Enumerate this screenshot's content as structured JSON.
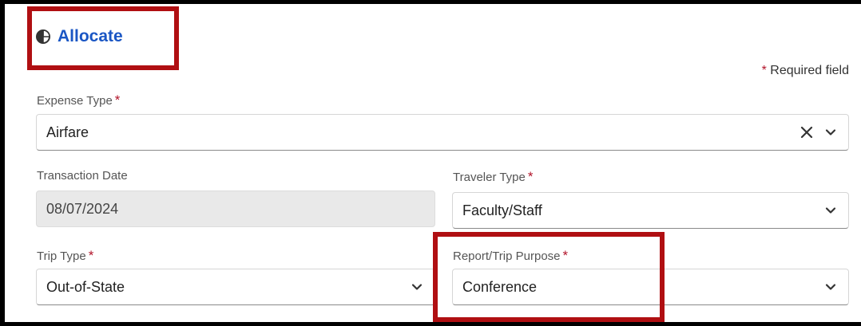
{
  "header": {
    "allocate_label": "Allocate",
    "allocate_icon": "pie-chart-icon",
    "required_note": "Required field",
    "required_marker": "*"
  },
  "fields": {
    "expense_type": {
      "label": "Expense Type",
      "value": "Airfare",
      "icons": [
        "clear-icon",
        "chevron-down-icon"
      ]
    },
    "transaction_date": {
      "label": "Transaction Date",
      "value": "08/07/2024"
    },
    "traveler_type": {
      "label": "Traveler Type",
      "value": "Faculty/Staff",
      "icons": [
        "chevron-down-icon"
      ]
    },
    "trip_type": {
      "label": "Trip Type",
      "value": "Out-of-State",
      "icons": [
        "chevron-down-icon"
      ]
    },
    "report_trip_purpose": {
      "label": "Report/Trip Purpose",
      "value": "Conference",
      "icons": [
        "chevron-down-icon"
      ]
    }
  },
  "colors": {
    "link": "#1a56c4",
    "required_star": "#b2142a",
    "highlight_box": "#b00f12"
  }
}
